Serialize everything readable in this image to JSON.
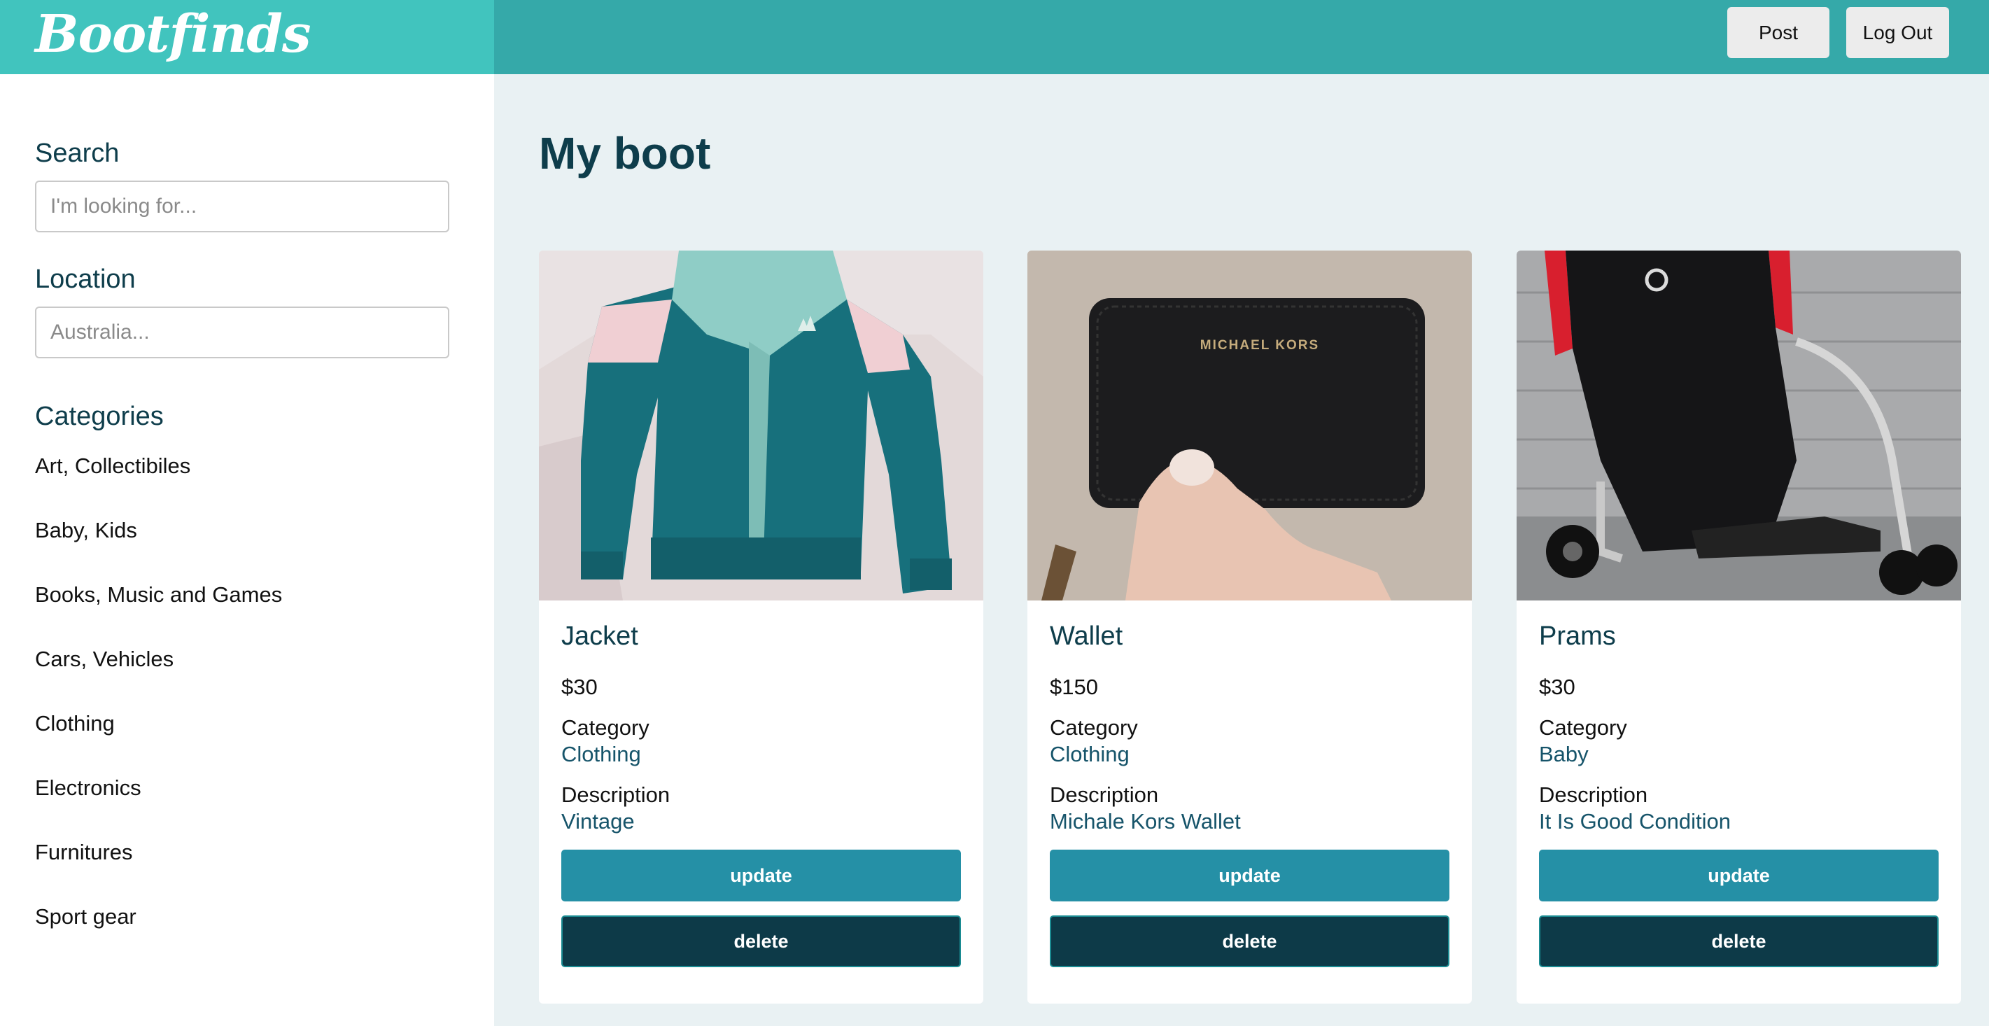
{
  "brand": {
    "logo_text": "Bootfinds"
  },
  "header": {
    "post_label": "Post",
    "logout_label": "Log Out"
  },
  "sidebar": {
    "search": {
      "label": "Search",
      "placeholder": "I'm looking for..."
    },
    "location": {
      "label": "Location",
      "placeholder": "Australia..."
    },
    "categories_label": "Categories",
    "categories": [
      "Art, Collectibiles",
      "Baby, Kids",
      "Books, Music and Games",
      "Cars, Vehicles",
      "Clothing",
      "Electronics",
      "Furnitures",
      "Sport gear"
    ]
  },
  "main": {
    "title": "My boot"
  },
  "listings": [
    {
      "title": "Jacket",
      "price": "$30",
      "category_label": "Category",
      "category": "Clothing",
      "description_label": "Description",
      "description": "Vintage",
      "update_label": "update",
      "delete_label": "delete"
    },
    {
      "title": "Wallet",
      "price": "$150",
      "category_label": "Category",
      "category": "Clothing",
      "description_label": "Description",
      "description": "Michale Kors Wallet",
      "update_label": "update",
      "delete_label": "delete",
      "image_text": "MICHAEL KORS"
    },
    {
      "title": "Prams",
      "price": "$30",
      "category_label": "Category",
      "category": "Baby",
      "description_label": "Description",
      "description": "It Is Good Condition",
      "update_label": "update",
      "delete_label": "delete"
    }
  ],
  "colors": {
    "header": "#35a9a9",
    "brand": "#41c4be",
    "update": "#2590a6",
    "delete": "#0d3a48",
    "heading": "#0e3d4b"
  }
}
